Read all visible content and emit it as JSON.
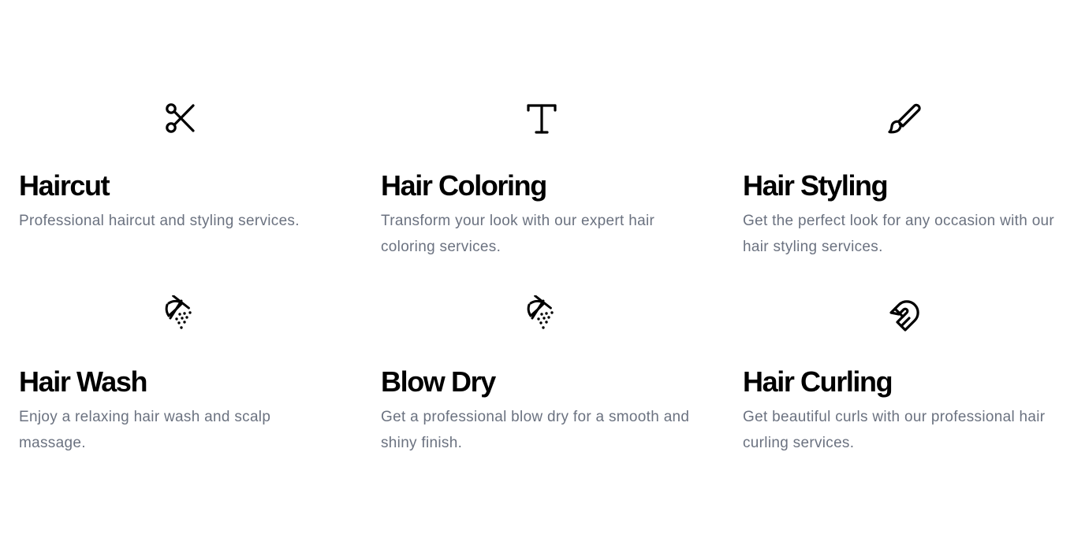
{
  "services": [
    {
      "icon": "scissors-icon",
      "title": "Haircut",
      "description": "Professional haircut and styling services."
    },
    {
      "icon": "text-t-icon",
      "title": "Hair Coloring",
      "description": "Transform your look with our expert hair coloring services."
    },
    {
      "icon": "paintbrush-icon",
      "title": "Hair Styling",
      "description": "Get the perfect look for any occasion with our hair styling services."
    },
    {
      "icon": "shower-icon",
      "title": "Hair Wash",
      "description": "Enjoy a relaxing hair wash and scalp massage."
    },
    {
      "icon": "shower-icon",
      "title": "Blow Dry",
      "description": "Get a professional blow dry for a smooth and shiny finish."
    },
    {
      "icon": "magnet-icon",
      "title": "Hair Curling",
      "description": "Get beautiful curls with our professional hair curling services."
    }
  ],
  "colors": {
    "title": "#000000",
    "description": "#6b7280",
    "background": "#ffffff"
  }
}
